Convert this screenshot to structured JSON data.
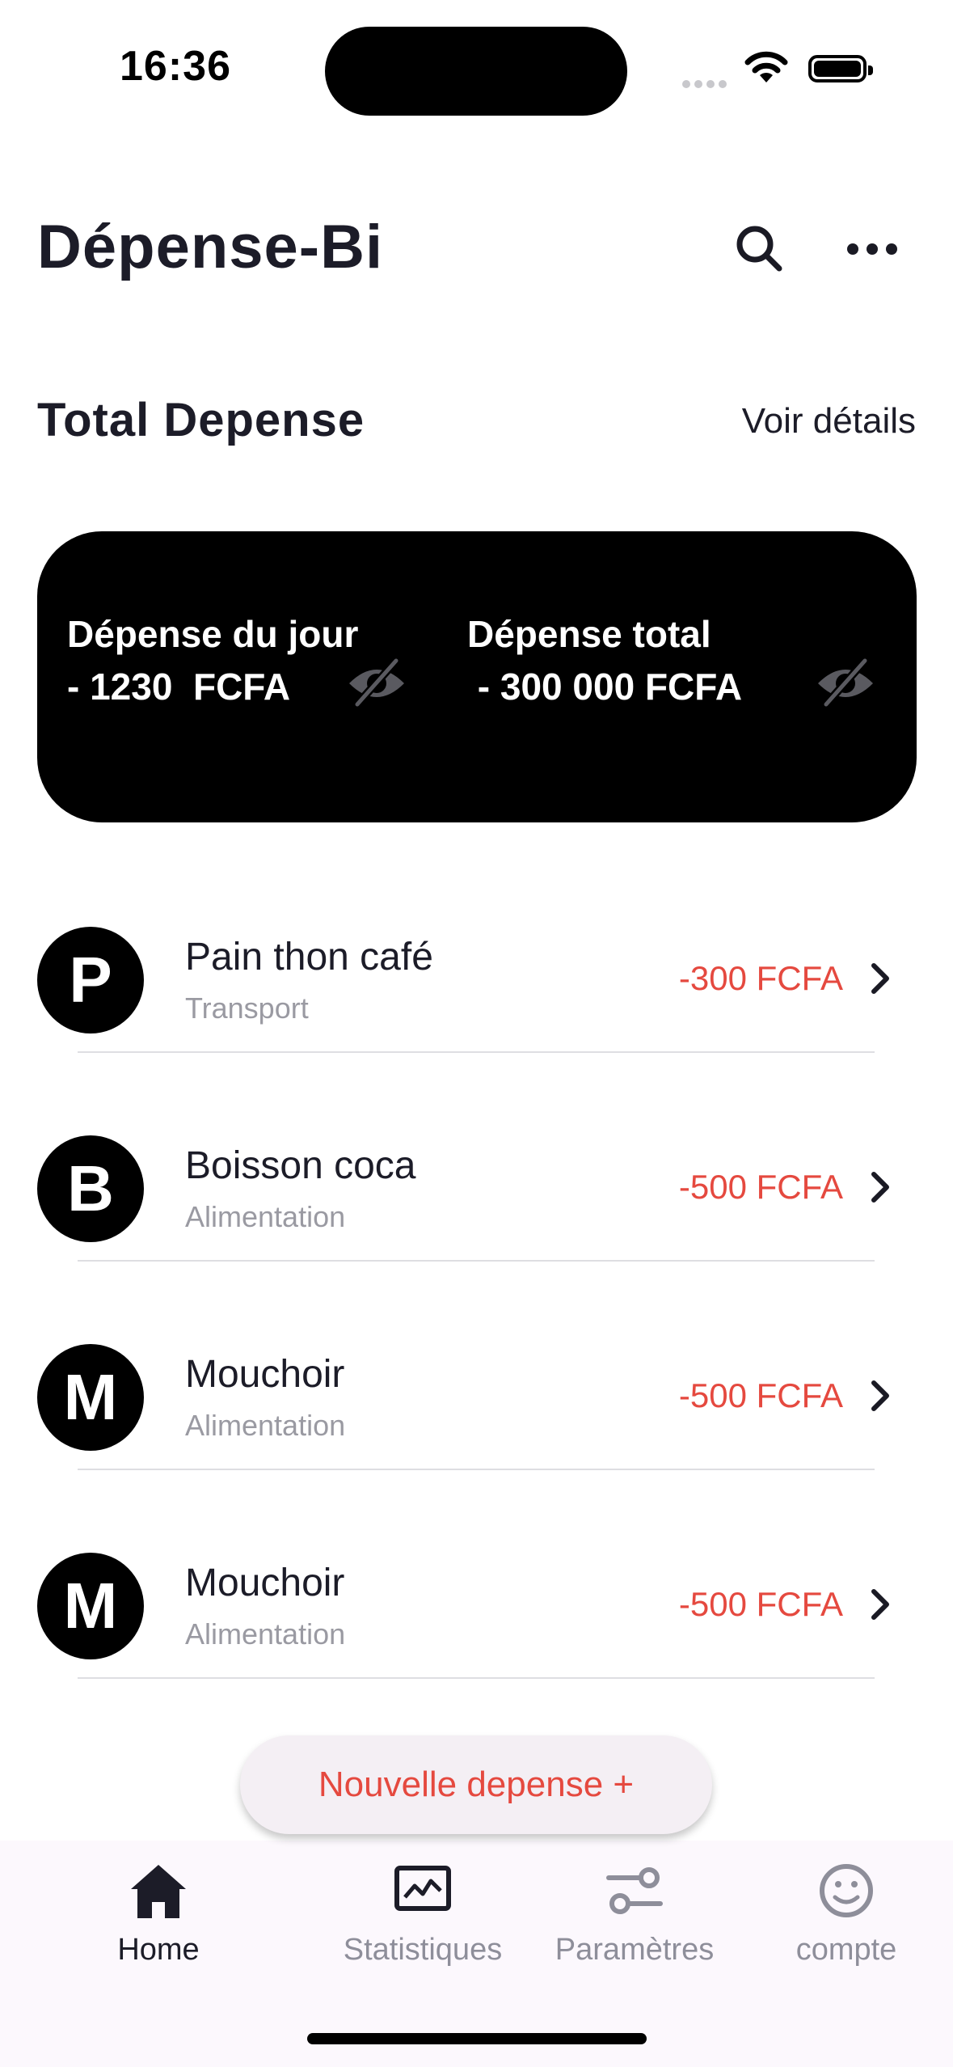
{
  "status_bar": {
    "time": "16:36"
  },
  "header": {
    "title": "Dépense-Bi"
  },
  "section": {
    "title": "Total Depense",
    "link": "Voir détails"
  },
  "summary": {
    "daily_label": "Dépense du jour",
    "daily_value": "- 1230  FCFA",
    "total_label": "Dépense total",
    "total_value": " - 300 000 FCFA"
  },
  "expenses": [
    {
      "initial": "P",
      "name": "Pain thon café",
      "category": "Transport",
      "amount": "-300 FCFA"
    },
    {
      "initial": "B",
      "name": "Boisson coca",
      "category": "Alimentation",
      "amount": "-500 FCFA"
    },
    {
      "initial": "M",
      "name": "Mouchoir",
      "category": "Alimentation",
      "amount": "-500 FCFA"
    },
    {
      "initial": "M",
      "name": "Mouchoir",
      "category": "Alimentation",
      "amount": "-500 FCFA"
    }
  ],
  "new_button": {
    "label": "Nouvelle depense  +"
  },
  "nav": [
    {
      "label": "Home",
      "icon": "home-icon",
      "active": true
    },
    {
      "label": "Statistiques",
      "icon": "chart-icon",
      "active": false
    },
    {
      "label": "Paramètres",
      "icon": "sliders-icon",
      "active": false
    },
    {
      "label": "compte",
      "icon": "smiley-icon",
      "active": false
    }
  ],
  "colors": {
    "accent": "#e5493f",
    "card": "#000000",
    "nav_active": "#1c1c28",
    "nav_inactive": "#8e8e9a"
  }
}
